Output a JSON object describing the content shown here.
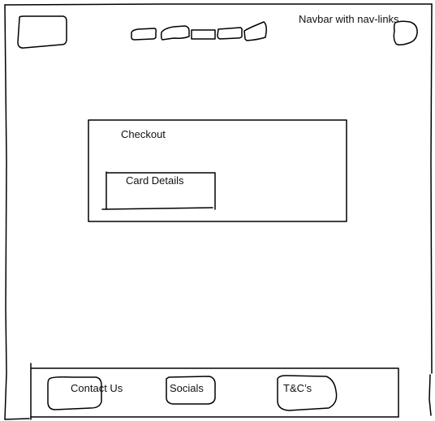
{
  "navbar": {
    "note": "Navbar with nav-links",
    "logo_icon": "logo-placeholder-icon",
    "profile_icon": "profile-placeholder-icon",
    "nav_links": [
      {
        "icon": "nav-link-placeholder"
      },
      {
        "icon": "nav-link-placeholder"
      },
      {
        "icon": "nav-link-placeholder"
      },
      {
        "icon": "nav-link-placeholder"
      },
      {
        "icon": "nav-link-placeholder"
      }
    ]
  },
  "checkout": {
    "title": "Checkout",
    "card_details_label": "Card Details"
  },
  "footer": {
    "contact_label": "Contact Us",
    "socials_label": "Socials",
    "terms_label": "T&C’s"
  }
}
